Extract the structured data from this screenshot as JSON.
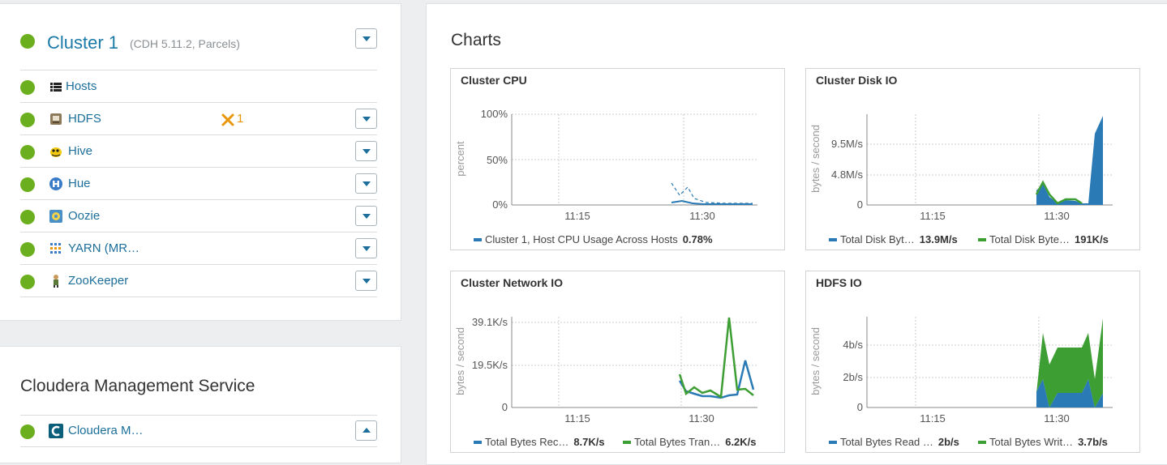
{
  "cluster": {
    "name": "Cluster 1",
    "meta": "(CDH 5.11.2, Parcels)",
    "services": [
      {
        "label": "Hosts",
        "icon": "hosts-icon",
        "has_menu": false
      },
      {
        "label": "HDFS",
        "icon": "hdfs-icon",
        "has_menu": true,
        "config_issues": "1"
      },
      {
        "label": "Hive",
        "icon": "hive-icon",
        "has_menu": true
      },
      {
        "label": "Hue",
        "icon": "hue-icon",
        "has_menu": true
      },
      {
        "label": "Oozie",
        "icon": "oozie-icon",
        "has_menu": true
      },
      {
        "label": "YARN (MR…",
        "icon": "yarn-icon",
        "has_menu": true
      },
      {
        "label": "ZooKeeper",
        "icon": "zookeeper-icon",
        "has_menu": true
      }
    ]
  },
  "cms": {
    "title": "Cloudera Management Service",
    "item_label": "Cloudera M…",
    "item_icon": "cloudera-icon"
  },
  "charts": {
    "title": "Charts",
    "cards": [
      {
        "title": "Cluster CPU",
        "ylabel": "percent",
        "yticks": [
          "100%",
          "50%",
          "0%"
        ],
        "xticks": [
          "11:15",
          "11:30"
        ],
        "legend": [
          {
            "label": "Cluster 1, Host CPU Usage Across Hosts",
            "value": "0.78%",
            "color": "#2a7ab5"
          }
        ]
      },
      {
        "title": "Cluster Disk IO",
        "ylabel": "bytes / second",
        "yticks": [
          "9.5M/s",
          "4.8M/s",
          "0"
        ],
        "xticks": [
          "11:15",
          "11:30"
        ],
        "legend": [
          {
            "label": "Total Disk Byt…",
            "value": "13.9M/s",
            "color": "#2a7ab5"
          },
          {
            "label": "Total Disk Byte…",
            "value": "191K/s",
            "color": "#3d9e34"
          }
        ]
      },
      {
        "title": "Cluster Network IO",
        "ylabel": "bytes / second",
        "yticks": [
          "39.1K/s",
          "19.5K/s",
          "0"
        ],
        "xticks": [
          "11:15",
          "11:30"
        ],
        "legend": [
          {
            "label": "Total Bytes Rec…",
            "value": "8.7K/s",
            "color": "#2a7ab5"
          },
          {
            "label": "Total Bytes Tran…",
            "value": "6.2K/s",
            "color": "#3d9e34"
          }
        ]
      },
      {
        "title": "HDFS IO",
        "ylabel": "bytes / second",
        "yticks": [
          "4b/s",
          "2b/s",
          "0"
        ],
        "xticks": [
          "11:15",
          "11:30"
        ],
        "legend": [
          {
            "label": "Total Bytes Read …",
            "value": "2b/s",
            "color": "#2a7ab5"
          },
          {
            "label": "Total Bytes Writ…",
            "value": "3.7b/s",
            "color": "#3d9e34"
          }
        ]
      }
    ]
  },
  "colors": {
    "status_good": "#6caf1e",
    "link": "#1c6f9a",
    "series_blue": "#2a7ab5",
    "series_green": "#3d9e34",
    "warning": "#e8960c"
  }
}
